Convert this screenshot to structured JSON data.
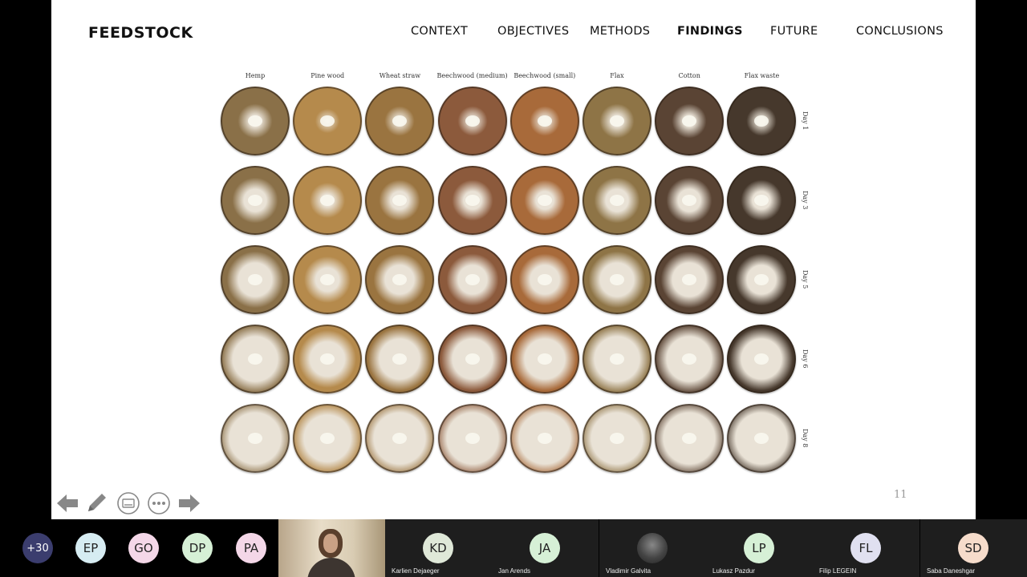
{
  "slide": {
    "brand": "FEEDSTOCK",
    "nav": [
      {
        "label": "CONTEXT",
        "active": false
      },
      {
        "label": "OBJECTIVES",
        "active": false
      },
      {
        "label": "METHODS",
        "active": false
      },
      {
        "label": "FINDINGS",
        "active": true
      },
      {
        "label": "FUTURE",
        "active": false
      },
      {
        "label": "CONCLUSIONS",
        "active": false
      }
    ],
    "columns": [
      "Hemp",
      "Pine wood",
      "Wheat straw",
      "Beechwood (medium)",
      "Beechwood (small)",
      "Flax",
      "Cotton",
      "Flax waste"
    ],
    "rows": [
      "Day 1",
      "Day 3",
      "Day 5",
      "Day 6",
      "Day 8"
    ],
    "page_number": "11",
    "substrate_colors": [
      "#8a7048",
      "#b58a4c",
      "#9a7440",
      "#8c5a3c",
      "#a86a3a",
      "#8e7446",
      "#5a4434",
      "#46382c"
    ],
    "mycelium_color": "#e9e2d6"
  },
  "controls": [
    {
      "name": "previous-slide-icon"
    },
    {
      "name": "pen-icon"
    },
    {
      "name": "subtitles-icon"
    },
    {
      "name": "more-options-icon"
    },
    {
      "name": "next-slide-icon"
    }
  ],
  "participants": {
    "more_count": "+30",
    "avatars": [
      {
        "initials": "EP",
        "color": "#d6ecf2"
      },
      {
        "initials": "GO",
        "color": "#f4d7e8"
      },
      {
        "initials": "DP",
        "color": "#d6f0d6"
      },
      {
        "initials": "PA",
        "color": "#f4d7e8"
      }
    ],
    "tiles": [
      {
        "name": "Karlien Dejaeger",
        "initials": "KD",
        "color": "#dfe8d8"
      },
      {
        "name": "Jan Arends",
        "initials": "JA",
        "color": "#d6f0d6"
      },
      {
        "name": "Vladimir Galvita",
        "initials": "",
        "color": "#555555"
      },
      {
        "name": "Lukasz Pazdur",
        "initials": "LP",
        "color": "#d6f0d6"
      },
      {
        "name": "Filip LEGEIN",
        "initials": "FL",
        "color": "#e0e0f0"
      },
      {
        "name": "Saba Daneshgar",
        "initials": "SD",
        "color": "#f6dccb"
      }
    ]
  }
}
